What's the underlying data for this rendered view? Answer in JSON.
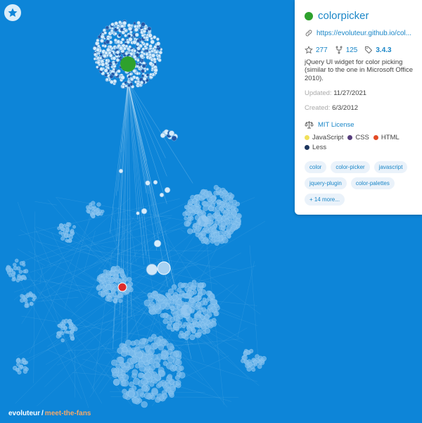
{
  "colors": {
    "background": "#0d85d8",
    "repo_dot": "#2ea12d",
    "link": "#1a86c7",
    "highlight_node": "#dd2c2c"
  },
  "toolbar": {
    "favorite_icon": "star-icon"
  },
  "breadcrumb": {
    "user": "evoluteur",
    "separator": "/",
    "project": "meet-the-fans"
  },
  "repo": {
    "name": "colorpicker",
    "url": "https://evoluteur.github.io/col...",
    "stars": "277",
    "forks": "125",
    "version": "3.4.3",
    "description": "jQuery UI widget for color picking (similar to the one in Microsoft Office 2010).",
    "updated_label": "Updated:",
    "updated": "11/27/2021",
    "created_label": "Created:",
    "created": "6/3/2012",
    "license": "MIT License",
    "languages": [
      {
        "name": "JavaScript",
        "color": "#f1e05a"
      },
      {
        "name": "CSS",
        "color": "#563d7c"
      },
      {
        "name": "HTML",
        "color": "#e34c26"
      },
      {
        "name": "Less",
        "color": "#1d365d"
      }
    ],
    "tags": [
      "color",
      "color-picker",
      "javascript",
      "jquery-plugin",
      "color-palettes",
      "+ 14 more..."
    ]
  }
}
